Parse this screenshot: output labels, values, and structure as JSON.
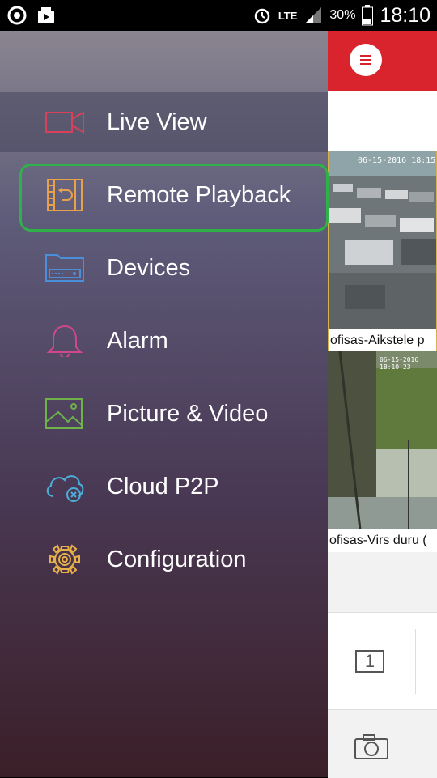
{
  "status_bar": {
    "battery": "30%",
    "network": "LTE",
    "time": "18:10"
  },
  "drawer": {
    "items": [
      {
        "label": "Live View",
        "icon": "video-camera-icon"
      },
      {
        "label": "Remote Playback",
        "icon": "playback-icon"
      },
      {
        "label": "Devices",
        "icon": "dvr-device-icon"
      },
      {
        "label": "Alarm",
        "icon": "bell-icon"
      },
      {
        "label": "Picture & Video",
        "icon": "picture-icon"
      },
      {
        "label": "Cloud P2P",
        "icon": "cloud-icon"
      },
      {
        "label": "Configuration",
        "icon": "gear-icon"
      }
    ]
  },
  "app": {
    "feeds": [
      {
        "label": "ofisas-Aikstele p",
        "timestamp": "06-15-2016 18:15"
      },
      {
        "label": "ofisas-Virs duru (",
        "timestamp": "06-15-2016 18:10:23"
      }
    ],
    "layout_button_text": "1"
  },
  "colors": {
    "accent_red": "#d9242d",
    "highlight_green": "#2fb14a",
    "live_view_icon": "#d9415b",
    "playback_icon": "#e8a14a",
    "devices_icon": "#4a8fd9",
    "alarm_icon": "#d0478c",
    "picture_icon": "#6fb24a",
    "cloud_icon": "#4ab0d9",
    "config_icon": "#e8b04a"
  }
}
